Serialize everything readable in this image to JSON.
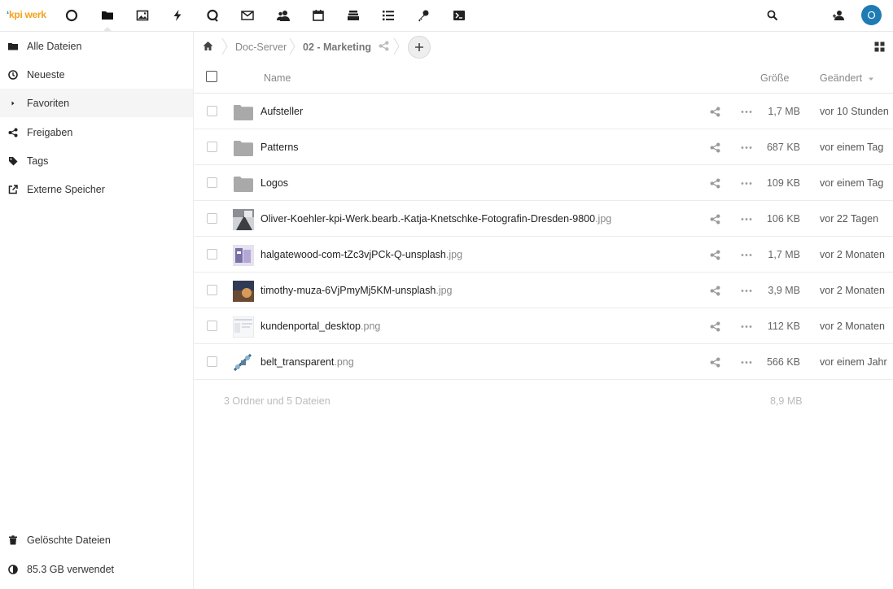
{
  "header": {
    "logo_mark": "ʻ",
    "logo_text": "kpi werk",
    "apps": [
      "dashboard-icon",
      "files-icon",
      "photos-icon",
      "activity-icon",
      "talk-icon",
      "mail-icon",
      "contacts-icon",
      "calendar-icon",
      "deck-icon",
      "tasks-icon",
      "passwords-icon",
      "terminal-icon"
    ],
    "avatar_initial": "O"
  },
  "sidebar": {
    "items": [
      {
        "label": "Alle Dateien",
        "icon": "folder-icon"
      },
      {
        "label": "Neueste",
        "icon": "clock-icon"
      },
      {
        "label": "Favoriten",
        "icon": "caret-right-icon"
      },
      {
        "label": "Freigaben",
        "icon": "share-icon"
      },
      {
        "label": "Tags",
        "icon": "tag-icon"
      },
      {
        "label": "Externe Speicher",
        "icon": "external-icon"
      }
    ],
    "trash_label": "Gelöschte Dateien",
    "quota_label": "85.3 GB verwendet"
  },
  "breadcrumb": {
    "items": [
      "Doc-Server",
      "02 - Marketing"
    ]
  },
  "table": {
    "columns": {
      "name": "Name",
      "size": "Größe",
      "modified": "Geändert"
    },
    "rows": [
      {
        "type": "folder",
        "name": "Aufsteller",
        "ext": "",
        "size": "1,7 MB",
        "modified": "vor 10 Stunden"
      },
      {
        "type": "folder",
        "name": "Patterns",
        "ext": "",
        "size": "687 KB",
        "modified": "vor einem Tag"
      },
      {
        "type": "folder",
        "name": "Logos",
        "ext": "",
        "size": "109 KB",
        "modified": "vor einem Tag"
      },
      {
        "type": "image",
        "name": "Oliver-Koehler-kpi-Werk.bearb.-Katja-Knetschke-Fotografin-Dresden-9800",
        "ext": ".jpg",
        "size": "106 KB",
        "modified": "vor 22 Tagen",
        "thumb": "thumb-photo-1"
      },
      {
        "type": "image",
        "name": "halgatewood-com-tZc3vjPCk-Q-unsplash",
        "ext": ".jpg",
        "size": "1,7 MB",
        "modified": "vor 2 Monaten",
        "thumb": "thumb-photo-2"
      },
      {
        "type": "image",
        "name": "timothy-muza-6VjPmyMj5KM-unsplash",
        "ext": ".jpg",
        "size": "3,9 MB",
        "modified": "vor 2 Monaten",
        "thumb": "thumb-photo-3"
      },
      {
        "type": "image",
        "name": "kundenportal_desktop",
        "ext": ".png",
        "size": "112 KB",
        "modified": "vor 2 Monaten",
        "thumb": "thumb-screenshot"
      },
      {
        "type": "image",
        "name": "belt_transparent",
        "ext": ".png",
        "size": "566 KB",
        "modified": "vor einem Jahr",
        "thumb": "thumb-belt"
      }
    ],
    "summary": "3 Ordner und 5 Dateien",
    "summary_size": "8,9 MB"
  },
  "colors": {
    "accent": "#1f7bb3",
    "logo_blue": "#1c8fd0",
    "logo_orange": "#f4a11d",
    "folder": "#a9a9a9"
  }
}
